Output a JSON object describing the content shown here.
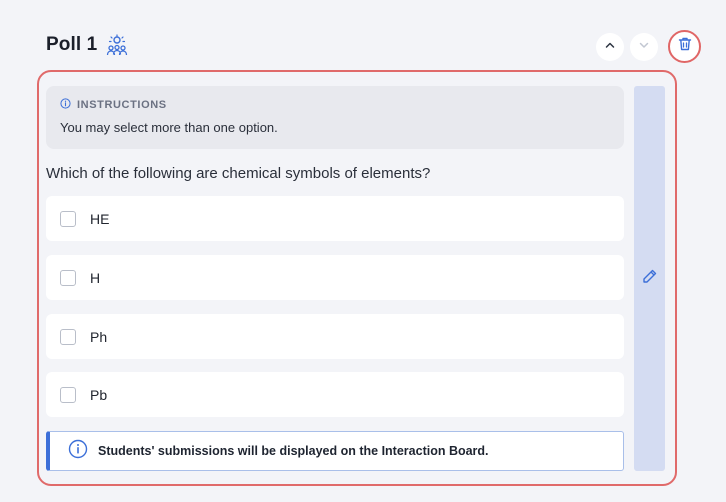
{
  "header": {
    "title": "Poll 1",
    "poll_icon": "presenter-audience-icon",
    "move_up_icon": "chevron-up-icon",
    "move_down_icon": "chevron-down-icon",
    "delete_icon": "trash-icon"
  },
  "instructions": {
    "heading": "INSTRUCTIONS",
    "text": "You may select more than one option."
  },
  "question": "Which of the following are chemical symbols of elements?",
  "options": [
    {
      "label": "HE",
      "checked": false
    },
    {
      "label": "H",
      "checked": false
    },
    {
      "label": "Ph",
      "checked": false
    },
    {
      "label": "Pb",
      "checked": false
    }
  ],
  "notice": {
    "text": "Students' submissions will be displayed on the Interaction Board."
  },
  "edit": {
    "icon": "pencil-icon"
  },
  "colors": {
    "accent": "#3c6fd8",
    "highlight_border": "#e06a6a",
    "edit_bar": "#d4dcf2",
    "background": "#f3f4f8"
  }
}
